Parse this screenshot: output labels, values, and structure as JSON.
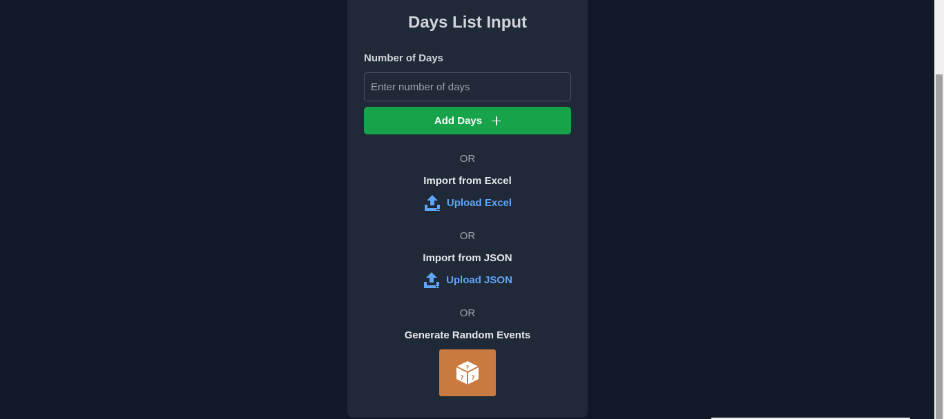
{
  "panel": {
    "title": "Days List Input",
    "number_of_days": {
      "label": "Number of Days",
      "placeholder": "Enter number of days",
      "value": ""
    },
    "add_button": {
      "label": "Add Days",
      "icon": "plus-icon"
    },
    "or_text": "OR",
    "excel": {
      "heading": "Import from Excel",
      "link_label": "Upload Excel",
      "icon": "upload-icon"
    },
    "json": {
      "heading": "Import from JSON",
      "link_label": "Upload JSON",
      "icon": "upload-icon"
    },
    "random": {
      "heading": "Generate Random Events",
      "icon": "dice-icon"
    }
  },
  "colors": {
    "background": "#111827",
    "panel": "#1f2937",
    "accent_green": "#16a34a",
    "link_blue": "#60a5fa",
    "dice_orange": "#c97a40"
  }
}
